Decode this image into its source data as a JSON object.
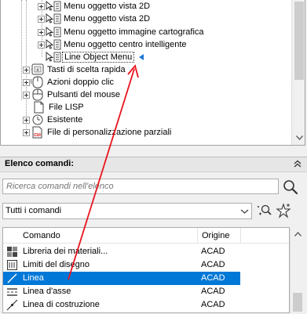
{
  "tree": {
    "items": [
      {
        "label": "Menu oggetto vista 2D",
        "icon": "menu-node-icon"
      },
      {
        "label": "Menu oggetto vista 2D",
        "icon": "menu-node-icon"
      },
      {
        "label": "Menu oggetto immagine cartografica",
        "icon": "menu-node-icon"
      },
      {
        "label": "Menu oggetto centro intelligente",
        "icon": "menu-node-icon"
      },
      {
        "label": "Line Object Menu",
        "icon": "menu-node-icon"
      },
      {
        "label": "Tasti di scelta rapida",
        "icon": "shortcut-keys-icon"
      },
      {
        "label": "Azioni doppio clic",
        "icon": "double-click-icon"
      },
      {
        "label": "Pulsanti del mouse",
        "icon": "mouse-icon"
      },
      {
        "label": "File LISP",
        "icon": "lisp-file-icon"
      },
      {
        "label": "Esistente",
        "icon": "clock-icon"
      },
      {
        "label": "File di personalizzazione parziali",
        "icon": "cui-file-icon"
      }
    ]
  },
  "commands": {
    "title": "Elenco comandi:",
    "search_placeholder": "Ricerca comandi nell'elenco",
    "filter_value": "Tutti i comandi",
    "columns": {
      "command": "Comando",
      "source": "Origine"
    },
    "rows": [
      {
        "name": "Libreria dei materiali...",
        "source": "ACAD",
        "icon": "material-library-icon"
      },
      {
        "name": "Limiti del disegno",
        "source": "ACAD",
        "icon": "drawing-limits-icon"
      },
      {
        "name": "Linea",
        "source": "ACAD",
        "icon": "line-icon",
        "selected": true
      },
      {
        "name": "Linea d'asse",
        "source": "ACAD",
        "icon": "centerline-icon"
      },
      {
        "name": "Linea di costruzione",
        "source": "ACAD",
        "icon": "construction-line-icon"
      }
    ]
  },
  "colors": {
    "selection": "#0078d7",
    "annotation_arrow": "#e8141e",
    "marker": "#1e78d6"
  }
}
